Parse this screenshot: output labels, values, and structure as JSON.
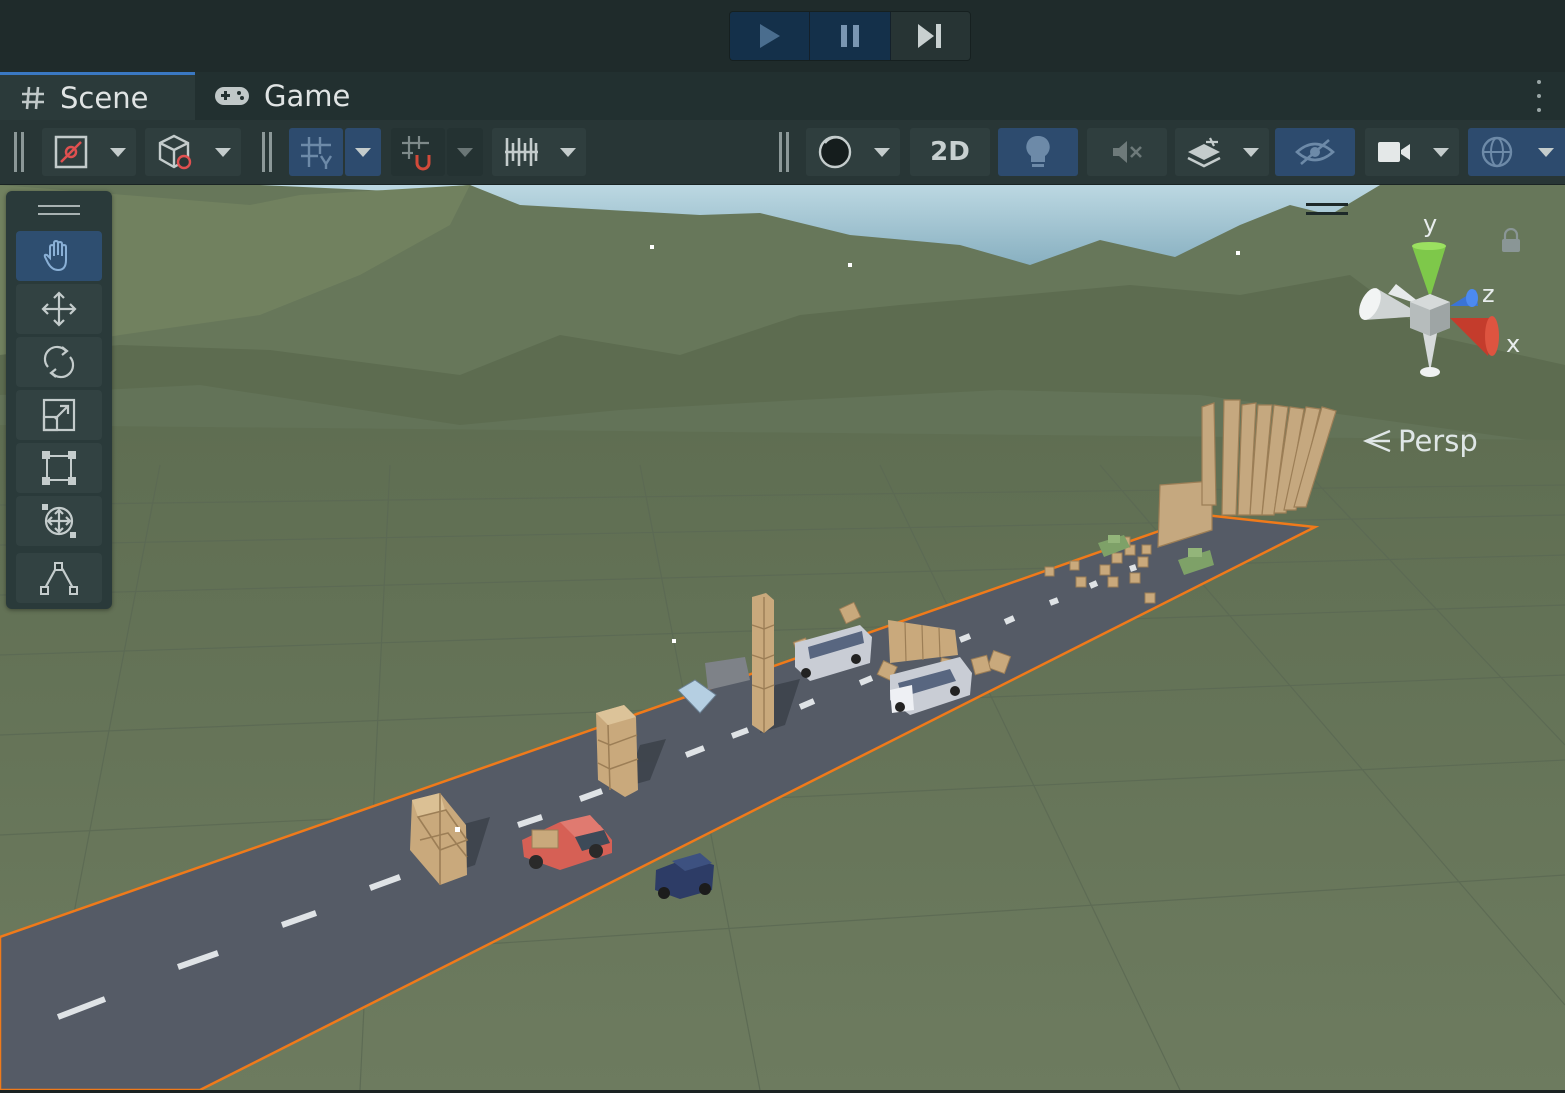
{
  "playbar": {
    "play": "play-icon",
    "pause": "pause-icon",
    "step": "step-icon"
  },
  "tabs": [
    {
      "label": "Scene",
      "icon": "grid-hash-icon",
      "active": true
    },
    {
      "label": "Game",
      "icon": "gamepad-icon",
      "active": false
    }
  ],
  "toolbar": {
    "mode_2d_label": "2D"
  },
  "tools": [
    {
      "name": "hand",
      "icon": "hand-icon",
      "active": true
    },
    {
      "name": "move",
      "icon": "move-icon",
      "active": false
    },
    {
      "name": "rotate",
      "icon": "rotate-icon",
      "active": false
    },
    {
      "name": "scale",
      "icon": "scale-icon",
      "active": false
    },
    {
      "name": "rect",
      "icon": "rect-transform-icon",
      "active": false
    },
    {
      "name": "transform",
      "icon": "transform-icon",
      "active": false
    },
    {
      "name": "custom",
      "icon": "custom-tool-icon",
      "active": false
    }
  ],
  "gizmo": {
    "y_label": "y",
    "z_label": "z",
    "x_label": "x"
  },
  "projection_label": "Persp",
  "colors": {
    "accent_blue": "#2d4b6e",
    "selection_orange": "#f07a1a",
    "ground": "#6b7a5e",
    "road": "#555b66"
  }
}
